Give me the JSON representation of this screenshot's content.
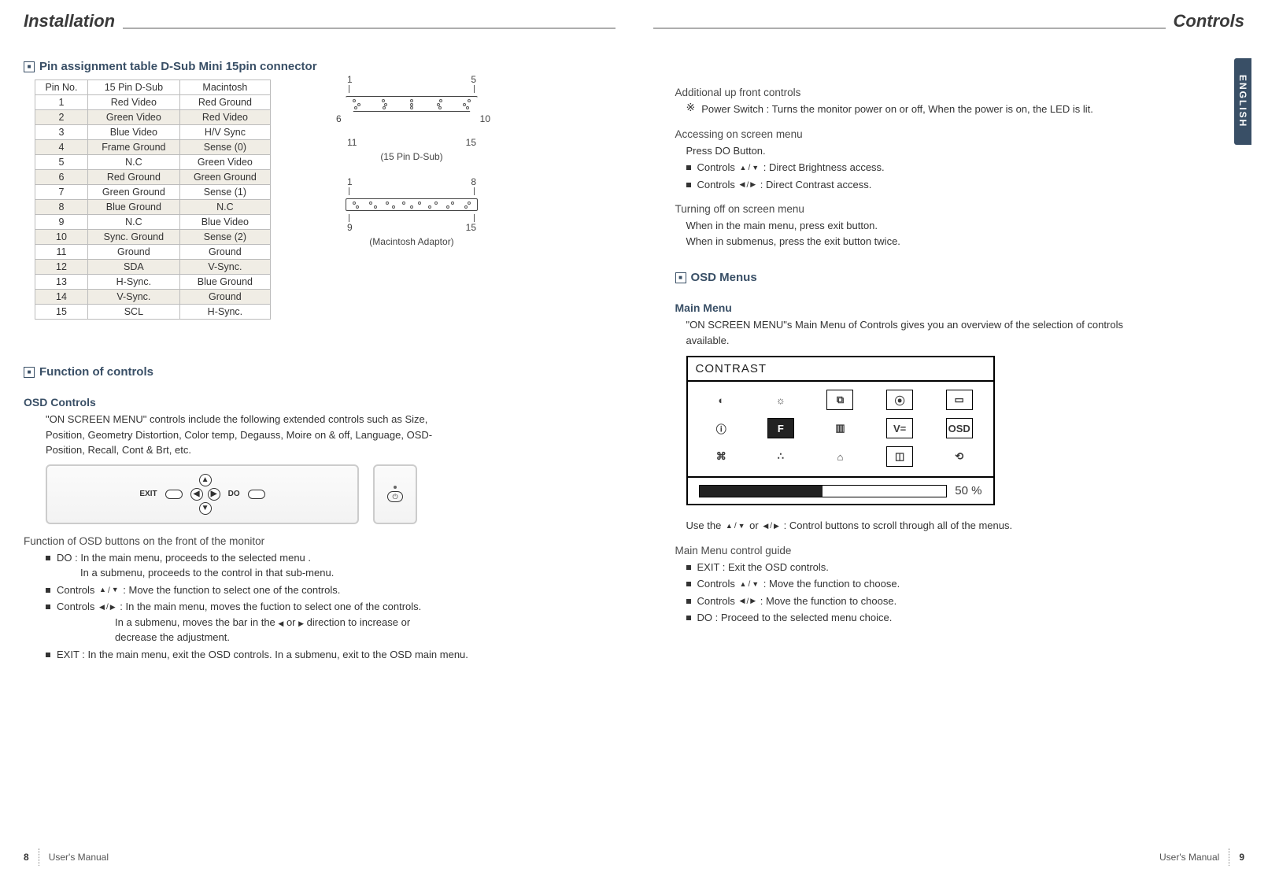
{
  "left": {
    "page_title": "Installation",
    "section1": "Pin assignment table D-Sub Mini 15pin connector",
    "pin_header": [
      "Pin No.",
      "15 Pin D-Sub",
      "Macintosh"
    ],
    "pins": [
      [
        "1",
        "Red Video",
        "Red Ground"
      ],
      [
        "2",
        "Green Video",
        "Red Video"
      ],
      [
        "3",
        "Blue Video",
        "H/V Sync"
      ],
      [
        "4",
        "Frame Ground",
        "Sense (0)"
      ],
      [
        "5",
        "N.C",
        "Green Video"
      ],
      [
        "6",
        "Red Ground",
        "Green Ground"
      ],
      [
        "7",
        "Green Ground",
        "Sense (1)"
      ],
      [
        "8",
        "Blue Ground",
        "N.C"
      ],
      [
        "9",
        "N.C",
        "Blue Video"
      ],
      [
        "10",
        "Sync. Ground",
        "Sense (2)"
      ],
      [
        "11",
        "Ground",
        "Ground"
      ],
      [
        "12",
        "SDA",
        "V-Sync."
      ],
      [
        "13",
        "H-Sync.",
        "Blue Ground"
      ],
      [
        "14",
        "V-Sync.",
        "Ground"
      ],
      [
        "15",
        "SCL",
        "H-Sync."
      ]
    ],
    "conn1": {
      "t1": "1",
      "t2": "5",
      "m1": "6",
      "m2": "10",
      "b1": "11",
      "b2": "15",
      "cap": "(15 Pin D-Sub)"
    },
    "conn2": {
      "t1": "1",
      "t2": "8",
      "b1": "9",
      "b2": "15",
      "cap": "(Macintosh Adaptor)"
    },
    "section2": "Function of controls",
    "sub2": "OSD Controls",
    "desc2": "\"ON SCREEN MENU\" controls include the following extended controls such as Size, Position, Geometry Distortion, Color temp, Degauss, Moire on & off, Language, OSD-Position, Recall, Cont & Brt, etc.",
    "panel": {
      "exit": "EXIT",
      "do": "DO"
    },
    "sub3": "Function of OSD buttons on the front of the monitor",
    "b1a": "DO : In the main menu, proceeds to the selected menu .",
    "b1b": "In a submenu, proceeds to the control in that sub-menu.",
    "b2pre": "Controls ",
    "b2suf": " : Move the function to select one of the controls.",
    "b3pre": "Controls ",
    "b3suf": " : In the main menu, moves the fuction to select one of the controls.",
    "b3c_pre": "In a submenu, moves the bar in the ",
    "b3c_mid": " or ",
    "b3c_suf": " direction to increase or",
    "b3d": "decrease the adjustment.",
    "b4": "EXIT : In the main menu, exit the OSD controls. In a submenu, exit to the OSD main menu.",
    "footer_pn": "8",
    "footer_label": "User's Manual"
  },
  "right": {
    "page_title": "Controls",
    "lang": "ENGLISH",
    "sub1": "Additional up front controls",
    "sub1a": "Power Switch : Turns the monitor power on or off, When the power is on, the LED is lit.",
    "sub2": "Accessing on screen menu",
    "sub2a": "Press DO Button.",
    "sub2b_pre": "Controls ",
    "sub2b_suf": " : Direct Brightness access.",
    "sub2c_pre": "Controls ",
    "sub2c_suf": " : Direct Contrast access.",
    "sub3": "Turning off on screen menu",
    "sub3a": "When in the main menu, press exit button.",
    "sub3b": "When in submenus, press the exit button twice.",
    "section_osd": "OSD Menus",
    "sub4": "Main Menu",
    "sub4a": "\"ON SCREEN MENU\"s Main Menu of Controls gives you an overview of the selection of controls available.",
    "osd_title": "CONTRAST",
    "osd_icons": [
      "◐",
      "☼",
      "⧉",
      "⦿",
      "▭",
      "ⓘ",
      "F",
      "▥",
      "V=",
      "OSD",
      "⌘",
      "∴",
      "⌂",
      "◫",
      "⟲"
    ],
    "osd_value": "50 %",
    "use_pre": "Use the ",
    "use_mid": " or ",
    "use_suf": " : Control buttons to scroll through all of the menus.",
    "sub5": "Main Menu control guide",
    "g1": "EXIT : Exit the OSD controls.",
    "g2_pre": "Controls ",
    "g2_suf": " : Move the function to choose.",
    "g3_pre": "Controls ",
    "g3_suf": " : Move the function to choose.",
    "g4": "DO : Proceed to the selected menu choice.",
    "footer_label": "User's Manual",
    "footer_pn": "9"
  }
}
